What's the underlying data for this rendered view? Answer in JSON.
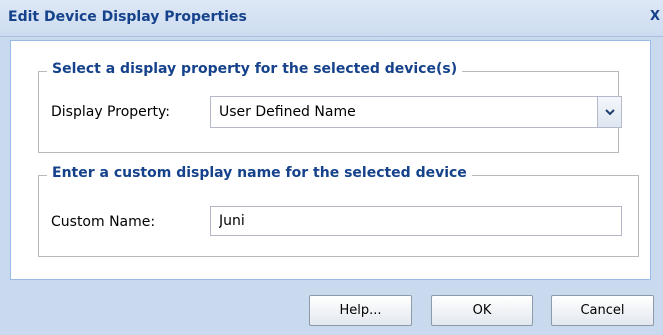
{
  "dialog": {
    "title": "Edit Device Display Properties",
    "close_glyph": "X"
  },
  "display_section": {
    "legend": "Select a display property for the selected device(s)",
    "label": "Display Property:",
    "selected_value": "User Defined Name",
    "dropdown_icon": "chevron-down-icon"
  },
  "custom_section": {
    "legend": "Enter a custom display name for the selected device",
    "label": "Custom Name:",
    "value": "Juni"
  },
  "buttons": {
    "help": "Help...",
    "ok": "OK",
    "cancel": "Cancel"
  },
  "colors": {
    "title_text": "#15428b",
    "dialog_background": "#c9d9ee",
    "panel_background": "#ffffff"
  }
}
